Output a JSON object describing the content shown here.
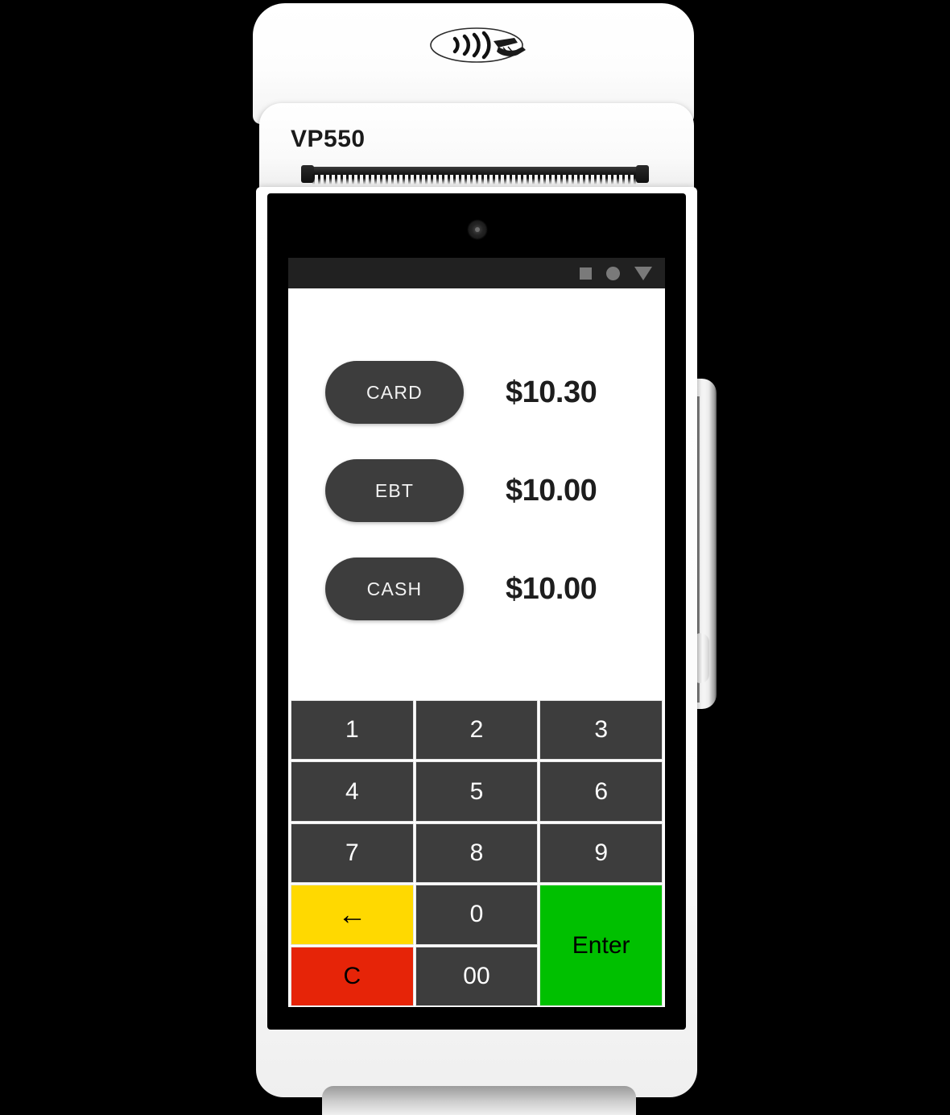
{
  "device": {
    "model_label": "VP550",
    "nfc_icon": "contactless-payment-icon",
    "printer": "receipt-tear-bar",
    "camera": "front-camera"
  },
  "screen": {
    "navbar": {
      "icons": [
        {
          "name": "recent-apps-square-icon",
          "glyph": "square"
        },
        {
          "name": "home-circle-icon",
          "glyph": "circle"
        },
        {
          "name": "back-triangle-icon",
          "glyph": "triangle-down"
        }
      ],
      "background_color": "#212121",
      "icon_color": "#7a7a7a"
    },
    "payment_options": [
      {
        "label": "CARD",
        "amount": "$10.30"
      },
      {
        "label": "EBT",
        "amount": "$10.00"
      },
      {
        "label": "CASH",
        "amount": "$10.00"
      }
    ],
    "keypad": {
      "keys": [
        {
          "label": "1",
          "type": "digit"
        },
        {
          "label": "2",
          "type": "digit"
        },
        {
          "label": "3",
          "type": "digit"
        },
        {
          "label": "4",
          "type": "digit"
        },
        {
          "label": "5",
          "type": "digit"
        },
        {
          "label": "6",
          "type": "digit"
        },
        {
          "label": "7",
          "type": "digit"
        },
        {
          "label": "8",
          "type": "digit"
        },
        {
          "label": "9",
          "type": "digit"
        },
        {
          "label": "←",
          "type": "backspace"
        },
        {
          "label": "0",
          "type": "digit"
        },
        {
          "label": "Enter",
          "type": "enter"
        },
        {
          "label": "C",
          "type": "clear"
        },
        {
          "label": "00",
          "type": "digit"
        }
      ],
      "colors": {
        "digit": "#3d3d3d",
        "backspace": "#FFD900",
        "clear": "#E62408",
        "enter": "#00C000"
      }
    }
  }
}
